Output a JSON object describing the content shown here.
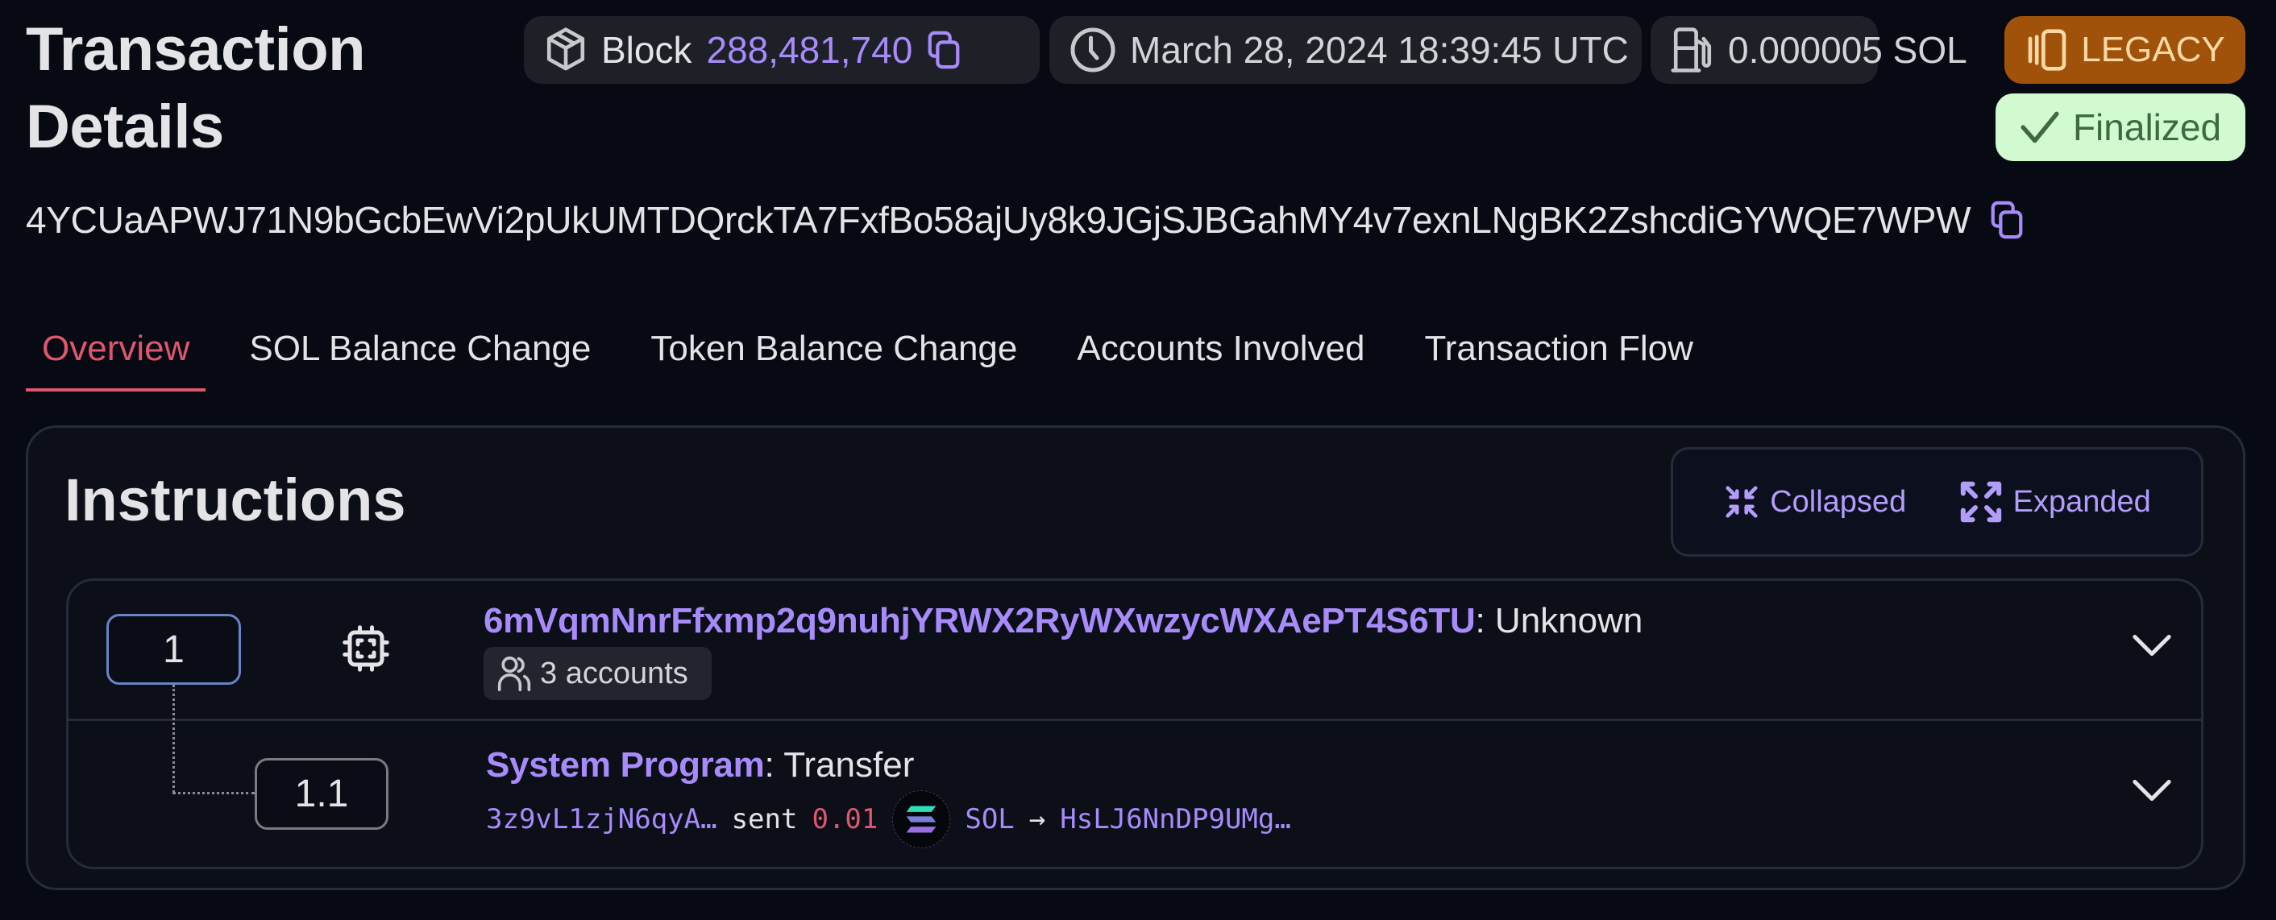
{
  "page": {
    "title": "Transaction Details"
  },
  "header": {
    "block_label": "Block",
    "block_number": "288,481,740",
    "timestamp": "March 28, 2024 18:39:45 UTC",
    "fee": "0.000005 SOL",
    "version_badge": "LEGACY",
    "status_badge": "Finalized",
    "icons": {
      "block": "cube-icon",
      "copy": "copy-icon",
      "time": "clock-icon",
      "fee": "fuel-pump-icon",
      "version": "legacy-cards-icon",
      "status": "check-icon"
    }
  },
  "signature": "4YCUaAPWJ71N9bGcbEwVi2pUkUMTDQrckTA7FxfBo58ajUy8k9JGjSJBGahMY4v7exnLNgBK2ZshcdiGYWQE7WPW",
  "tabs": [
    {
      "label": "Overview",
      "active": true
    },
    {
      "label": "SOL Balance Change",
      "active": false
    },
    {
      "label": "Token Balance Change",
      "active": false
    },
    {
      "label": "Accounts Involved",
      "active": false
    },
    {
      "label": "Transaction Flow",
      "active": false
    }
  ],
  "instructions": {
    "title": "Instructions",
    "view_toggle": {
      "collapsed_label": "Collapsed",
      "expanded_label": "Expanded"
    },
    "items": [
      {
        "index": "1",
        "program": "6mVqmNnrFfxmp2q9nuhjYRWX2RyWXwzycWXAePT4S6TU",
        "separator": ":",
        "instruction": "Unknown",
        "accounts_label": "3 accounts",
        "icon": "cpu-chip-icon"
      },
      {
        "index": "1.1",
        "program": "System Program",
        "separator": ":",
        "instruction": "Transfer",
        "from": "3z9vL1zjN6qyA…",
        "verb": "sent",
        "amount": "0.01",
        "token": "SOL",
        "arrow": "→",
        "to": "HsLJ6NnDP9UMg…"
      }
    ]
  },
  "colors": {
    "background": "#070a12",
    "accent_purple": "#a78bfa",
    "active_tab": "#e0566f",
    "legacy_badge_bg": "#a0520a",
    "finalized_badge_bg": "#d1fad1",
    "amount_red": "#e0566f"
  }
}
